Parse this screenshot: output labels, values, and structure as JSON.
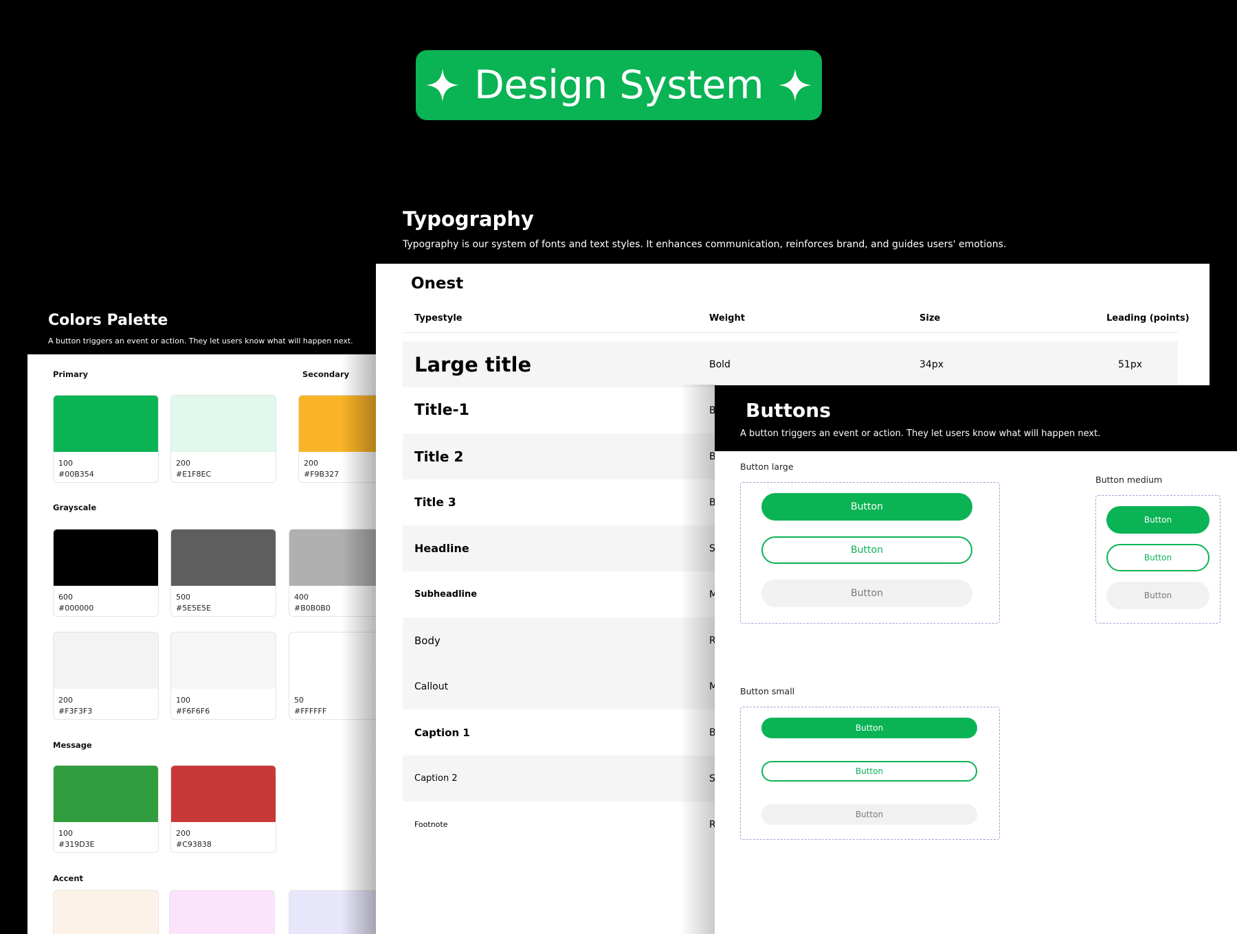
{
  "hero": {
    "title": "Design System"
  },
  "colors": {
    "title": "Colors Palette",
    "description": "A button triggers an event or action. They let users know what will happen next.",
    "primary_label": "Primary",
    "secondary_label": "Secondary",
    "grayscale_label": "Grayscale",
    "message_label": "Message",
    "accent_label": "Accent",
    "primary": [
      {
        "step": "100",
        "hex": "#00B354",
        "color": "#0ab354"
      },
      {
        "step": "200",
        "hex": "#E1F8EC",
        "color": "#e1f8ec"
      }
    ],
    "secondary": [
      {
        "step": "200",
        "hex": "#F9B327",
        "color": "#f9b327"
      }
    ],
    "grayscale": [
      {
        "step": "600",
        "hex": "#000000",
        "color": "#000000"
      },
      {
        "step": "500",
        "hex": "#5E5E5E",
        "color": "#5e5e5e"
      },
      {
        "step": "400",
        "hex": "#B0B0B0",
        "color": "#b0b0b0"
      },
      {
        "step": "200",
        "hex": "#F3F3F3",
        "color": "#f3f3f3"
      },
      {
        "step": "100",
        "hex": "#F6F6F6",
        "color": "#f6f6f6"
      },
      {
        "step": "50",
        "hex": "#FFFFFF",
        "color": "#ffffff"
      }
    ],
    "message": [
      {
        "step": "100",
        "hex": "#319D3E",
        "color": "#319d3e"
      },
      {
        "step": "200",
        "hex": "#C93838",
        "color": "#c93838"
      }
    ],
    "accent": [
      {
        "color": "#fdf2e7"
      },
      {
        "color": "#fbe4fb"
      },
      {
        "color": "#e7e6fa"
      }
    ]
  },
  "typography": {
    "title": "Typography",
    "description": "Typography is our system of fonts and text styles. It enhances communication, reinforces brand, and guides users' emotions.",
    "font_name": "Onest",
    "headers": {
      "typestyle": "Typestyle",
      "weight": "Weight",
      "size": "Size",
      "leading": "Leading (points)"
    },
    "rows": [
      {
        "name": "Large title",
        "weight": "Bold",
        "size": "34px",
        "leading": "51px"
      },
      {
        "name": "Title-1",
        "weight": "B"
      },
      {
        "name": "Title 2",
        "weight": "B"
      },
      {
        "name": "Title 3",
        "weight": "B"
      },
      {
        "name": "Headline",
        "weight": "S"
      },
      {
        "name": "Subheadline",
        "weight": "M"
      },
      {
        "name": "Body",
        "weight": "R"
      },
      {
        "name": "Callout",
        "weight": "M"
      },
      {
        "name": "Caption 1",
        "weight": "B"
      },
      {
        "name": "Caption 2",
        "weight": "S"
      },
      {
        "name": "Footnote",
        "weight": "R"
      }
    ]
  },
  "buttons": {
    "title": "Buttons",
    "description": "A button triggers an event or action. They let users know what will happen next.",
    "large_label": "Button large",
    "medium_label": "Button medium",
    "small_label": "Button small",
    "button_text": "Button"
  }
}
